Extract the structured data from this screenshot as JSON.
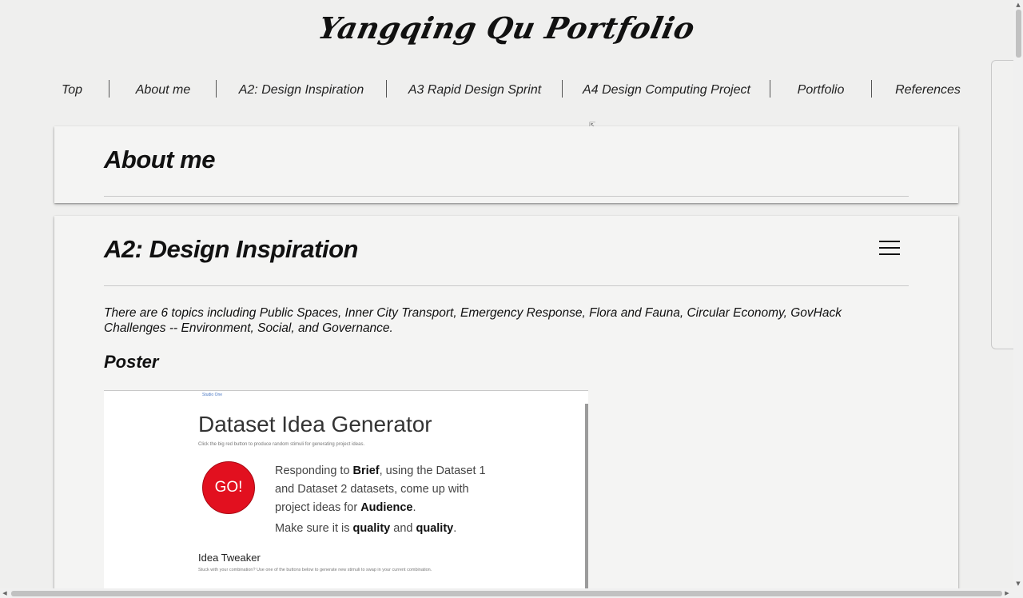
{
  "site": {
    "title": "Yangqing Qu Portfolio"
  },
  "nav": {
    "items": [
      "Top",
      "About me",
      "A2: Design Inspiration",
      "A3 Rapid Design Sprint",
      "A4 Design Computing Project",
      "Portfolio",
      "References"
    ]
  },
  "about": {
    "heading": "About me"
  },
  "a2": {
    "heading": "A2: Design Inspiration",
    "menu_icon": "hamburger-menu-icon",
    "topics": "There are 6 topics including Public Spaces, Inner City Transport, Emergency Response, Flora and Fauna, Circular Economy, GovHack Challenges -- Environment, Social, and Governance.",
    "poster_heading": "Poster",
    "poster": {
      "studio_label": "Studio One",
      "title": "Dataset Idea Generator",
      "subtitle": "Click the big red button to produce random stimuli for generating project ideas.",
      "go_label": "GO!",
      "line1_a": "Responding to ",
      "brief": "Brief",
      "line1_b": ", using the Dataset 1 and Dataset 2 datasets, come up with project ideas for ",
      "audience": "Audience",
      "line1_c": ".",
      "line2_a": "Make sure it is ",
      "quality1": "quality",
      "line2_b": " and ",
      "quality2": "quality",
      "line2_c": ".",
      "tweaker_title": "Idea Tweaker",
      "tweaker_sub": "Stuck with your combination? Use one of the buttons below to generate new stimuli to swap in your current combination."
    }
  },
  "scrollbars": {
    "up": "▲",
    "down": "▼",
    "left": "◀",
    "right": "▶"
  },
  "colors": {
    "background": "#efefee",
    "card": "#f4f4f3",
    "go_button": "#e2101f",
    "poster_link": "#4b79c4"
  }
}
